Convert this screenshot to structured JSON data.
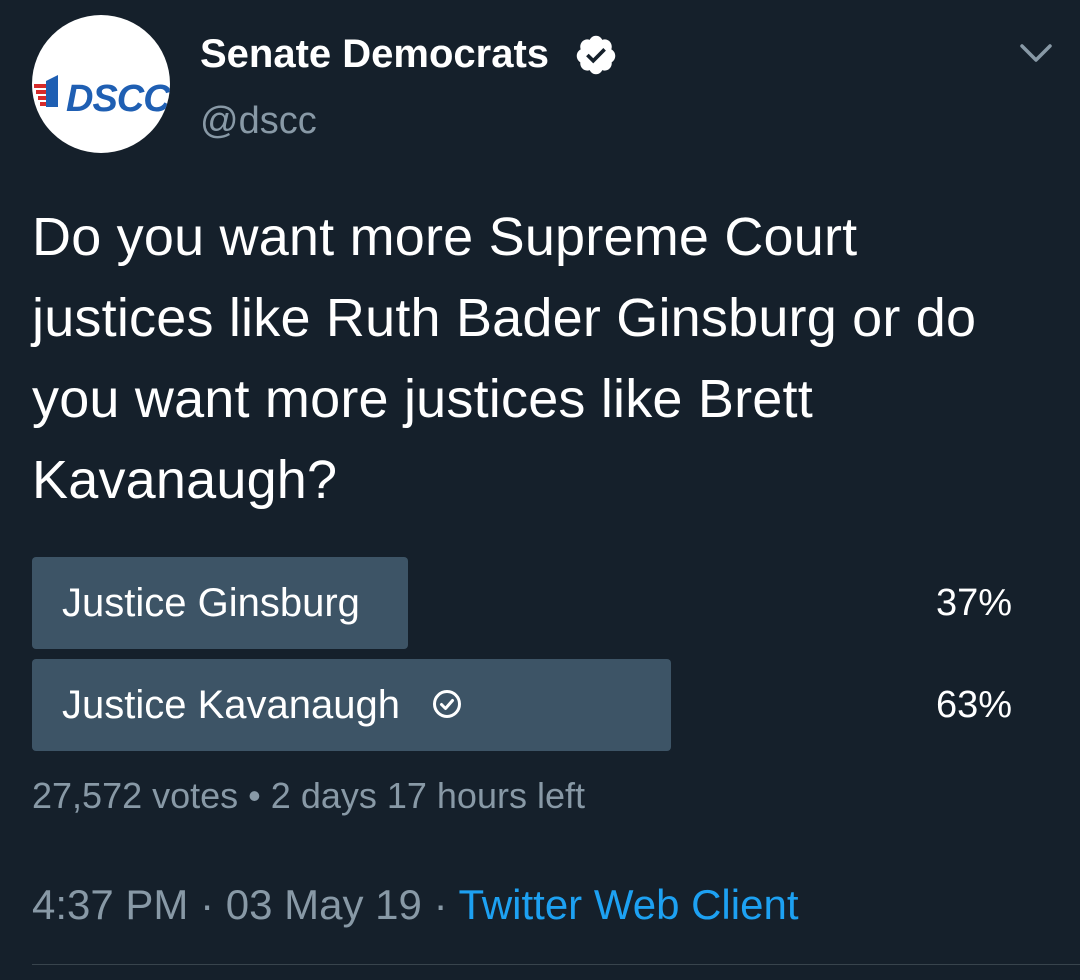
{
  "author": {
    "avatar_logo_text": "DSCC",
    "display_name": "Senate Democrats",
    "handle": "@dscc"
  },
  "tweet": {
    "text": "Do you want more Supreme Court justices like Ruth Bader Ginsburg or do you want more justices like Brett Kavanaugh?"
  },
  "poll": {
    "options": [
      {
        "label": "Justice Ginsburg",
        "percent_text": "37%",
        "percent": 37,
        "is_user_vote": false
      },
      {
        "label": "Justice Kavanaugh",
        "percent_text": "63%",
        "percent": 63,
        "is_user_vote": true
      }
    ],
    "votes": "27,572 votes",
    "separator": "•",
    "time_left": "2 days 17 hours left"
  },
  "meta": {
    "time": "4:37 PM",
    "separator": "·",
    "date": "03 May 19",
    "source": "Twitter Web Client"
  },
  "colors": {
    "background": "#15202b",
    "bar": "#3d5466",
    "secondary_text": "#8899a6",
    "link": "#1da1f2",
    "logo_blue": "#1f5fb3",
    "logo_red": "#d62b2b"
  },
  "icons": {
    "verified": "verified-badge-icon",
    "menu": "chevron-down-icon",
    "vote": "check-circle-icon"
  }
}
